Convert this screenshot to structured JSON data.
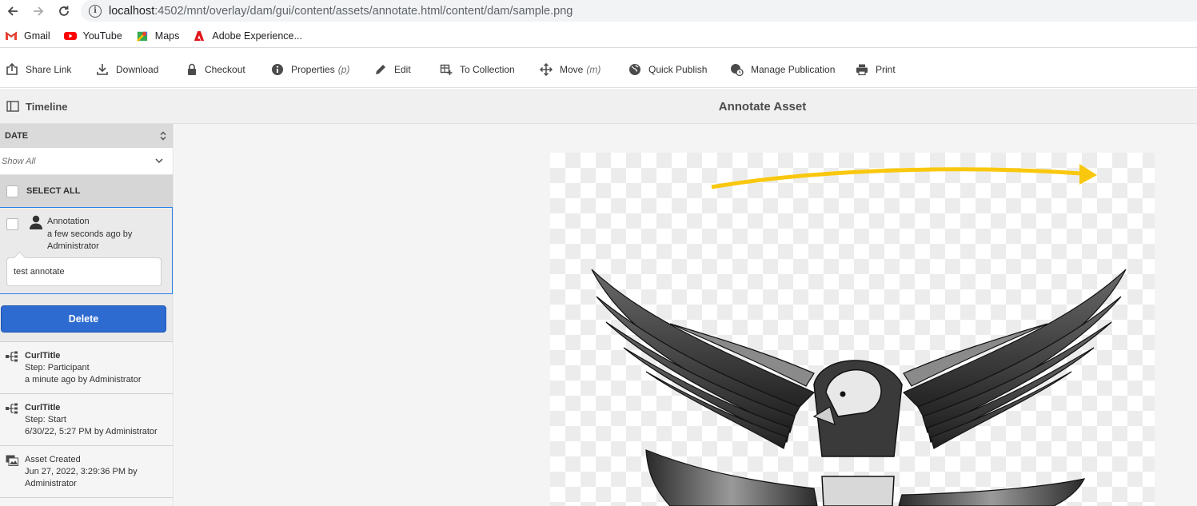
{
  "browser": {
    "url_host": "localhost",
    "url_path": ":4502/mnt/overlay/dam/gui/content/assets/annotate.html/content/dam/sample.png",
    "bookmarks": [
      {
        "label": "Gmail",
        "icon": "gmail-icon"
      },
      {
        "label": "YouTube",
        "icon": "youtube-icon"
      },
      {
        "label": "Maps",
        "icon": "maps-icon"
      },
      {
        "label": "Adobe Experience...",
        "icon": "adobe-icon"
      }
    ]
  },
  "actions": {
    "share_link": "Share Link",
    "download": "Download",
    "checkout": "Checkout",
    "properties": "Properties",
    "properties_key": "(p)",
    "edit": "Edit",
    "to_collection": "To Collection",
    "move": "Move",
    "move_key": "(m)",
    "quick_publish": "Quick Publish",
    "manage_publication": "Manage Publication",
    "print": "Print"
  },
  "header": {
    "rail_title": "Timeline",
    "page_title": "Annotate Asset"
  },
  "timeline": {
    "date_label": "DATE",
    "filter_value": "Show All",
    "select_all": "SELECT ALL",
    "annotation": {
      "title": "Annotation",
      "meta_1": "a few seconds ago by",
      "meta_2": "Administrator",
      "note": "test annotate"
    },
    "delete_label": "Delete",
    "events": [
      {
        "title": "CurlTitle",
        "line1": "Step: Participant",
        "line2": "a minute ago by Administrator"
      },
      {
        "title": "CurlTitle",
        "line1": "Step: Start",
        "line2": "6/30/22, 5:27 PM by Administrator"
      },
      {
        "title": "Asset Created",
        "line1": "Jun 27, 2022, 3:29:36 PM by",
        "line2": "Administrator"
      }
    ]
  },
  "colors": {
    "accent": "#2d6bd1",
    "annotation_arrow": "#f9c80e"
  }
}
